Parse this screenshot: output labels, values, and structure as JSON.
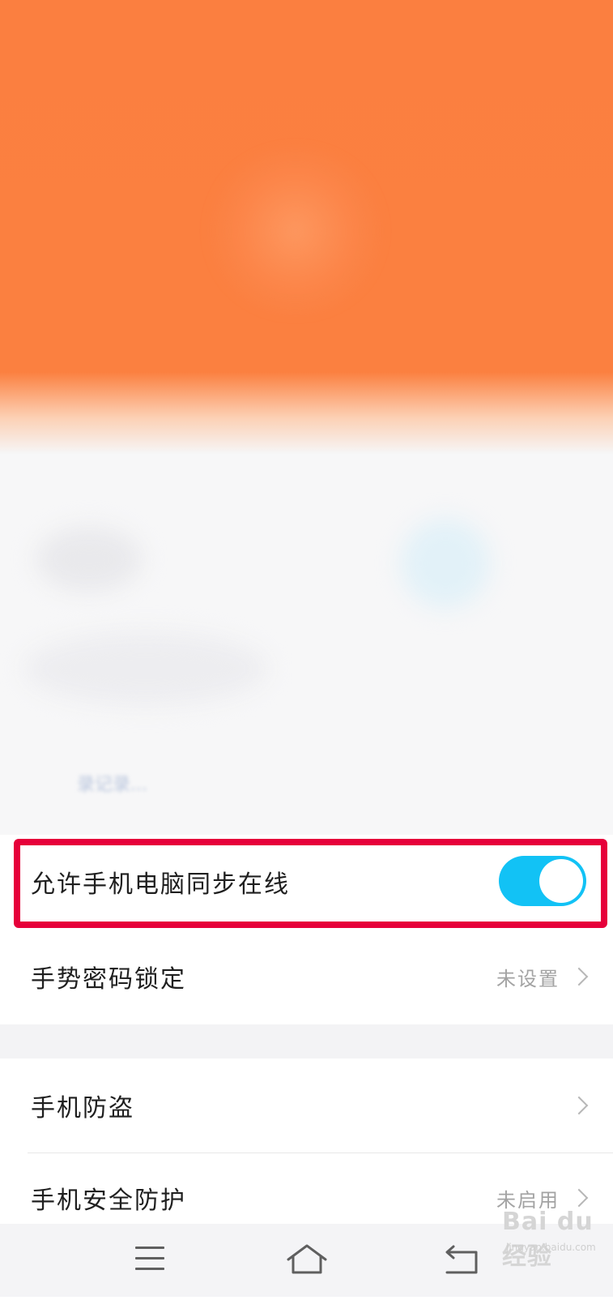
{
  "colors": {
    "hero_orange": "#fb8040",
    "toggle_on": "#12c2f5",
    "highlight_red": "#e6003a",
    "secondary_text": "#a3a3a3"
  },
  "blurred": {
    "partial_text": "录记录..."
  },
  "settings": {
    "sync_online": {
      "label": "允许手机电脑同步在线",
      "toggle_on": true
    },
    "gesture_lock": {
      "label": "手势密码锁定",
      "value": "未设置"
    },
    "anti_theft": {
      "label": "手机防盗"
    },
    "phone_security": {
      "label": "手机安全防护",
      "value": "未启用"
    }
  },
  "navbar": {
    "buttons": [
      "menu-icon",
      "home-icon",
      "back-icon"
    ]
  },
  "watermark": {
    "brand": "Bai du 经验",
    "url": "jingyan.baidu.com"
  }
}
